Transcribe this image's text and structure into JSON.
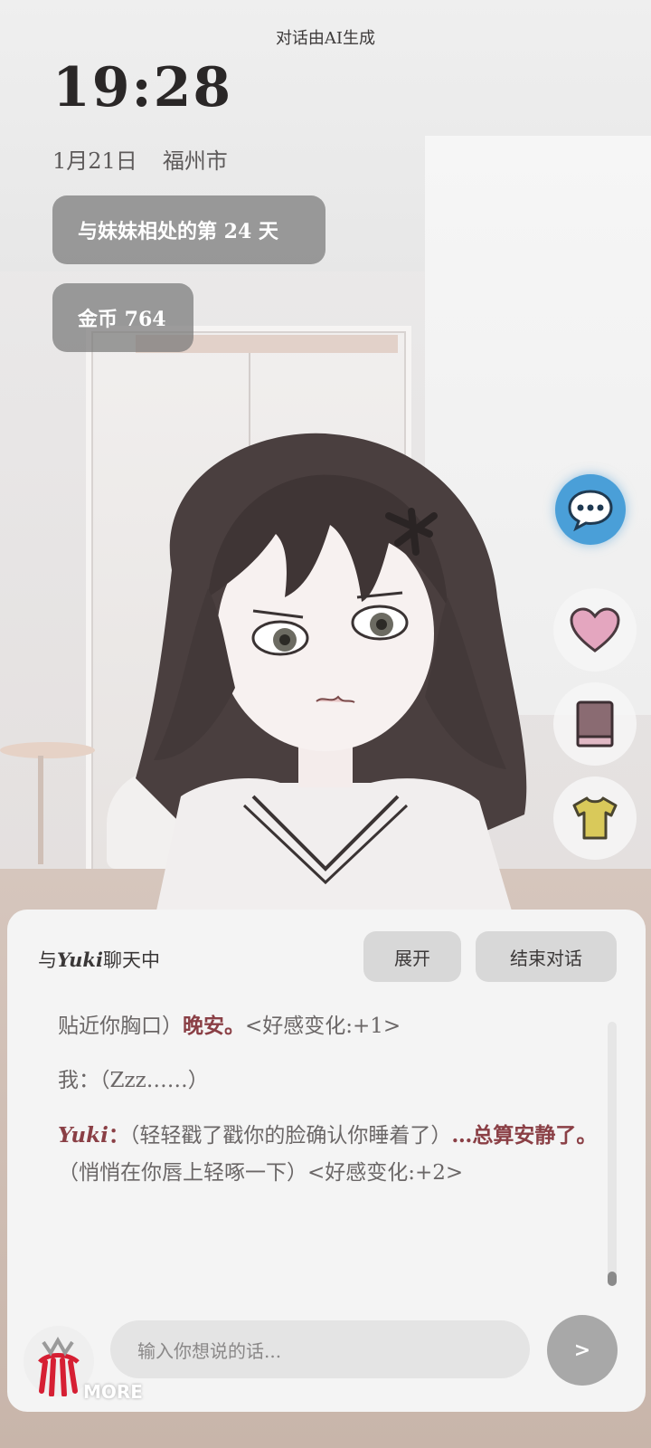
{
  "header": {
    "ai_notice": "对话由AI生成",
    "time": "19:28",
    "date": "1月21日",
    "city": "福州市",
    "days_label": "与妹妹相处的第 24 天",
    "coins_label": "金币 764"
  },
  "side_actions": [
    {
      "icon": "chat-bubble-icon",
      "color": "#4a9fd8"
    },
    {
      "icon": "heart-icon",
      "color": "#e4a6bf"
    },
    {
      "icon": "book-icon",
      "color": "#8a6b72"
    },
    {
      "icon": "tshirt-icon",
      "color": "#d9c95a"
    }
  ],
  "chat_panel": {
    "title_prefix": "与",
    "character_name": "Yuki",
    "title_suffix": "聊天中",
    "expand_label": "展开",
    "end_label": "结束对话",
    "log": {
      "line1_text": "贴近你胸口）",
      "line1_highlight": "晚安。",
      "line1_tail": "<好感变化:+1>",
      "line2_text": "我：（Zzz……）",
      "line3_speaker": "Yuki",
      "line3_colon": "：",
      "line3_part1": "（轻轻戳了戳你的脸确认你睡着了）",
      "line3_highlight": "…总算安静了。",
      "line3_part2": "（悄悄在你唇上轻啄一下）<好感变化:+2>"
    },
    "input_placeholder": "输入你想说的话...",
    "send_label": ">"
  },
  "footer": {
    "more_label": "MORE",
    "logo_color": "#d61f33"
  }
}
